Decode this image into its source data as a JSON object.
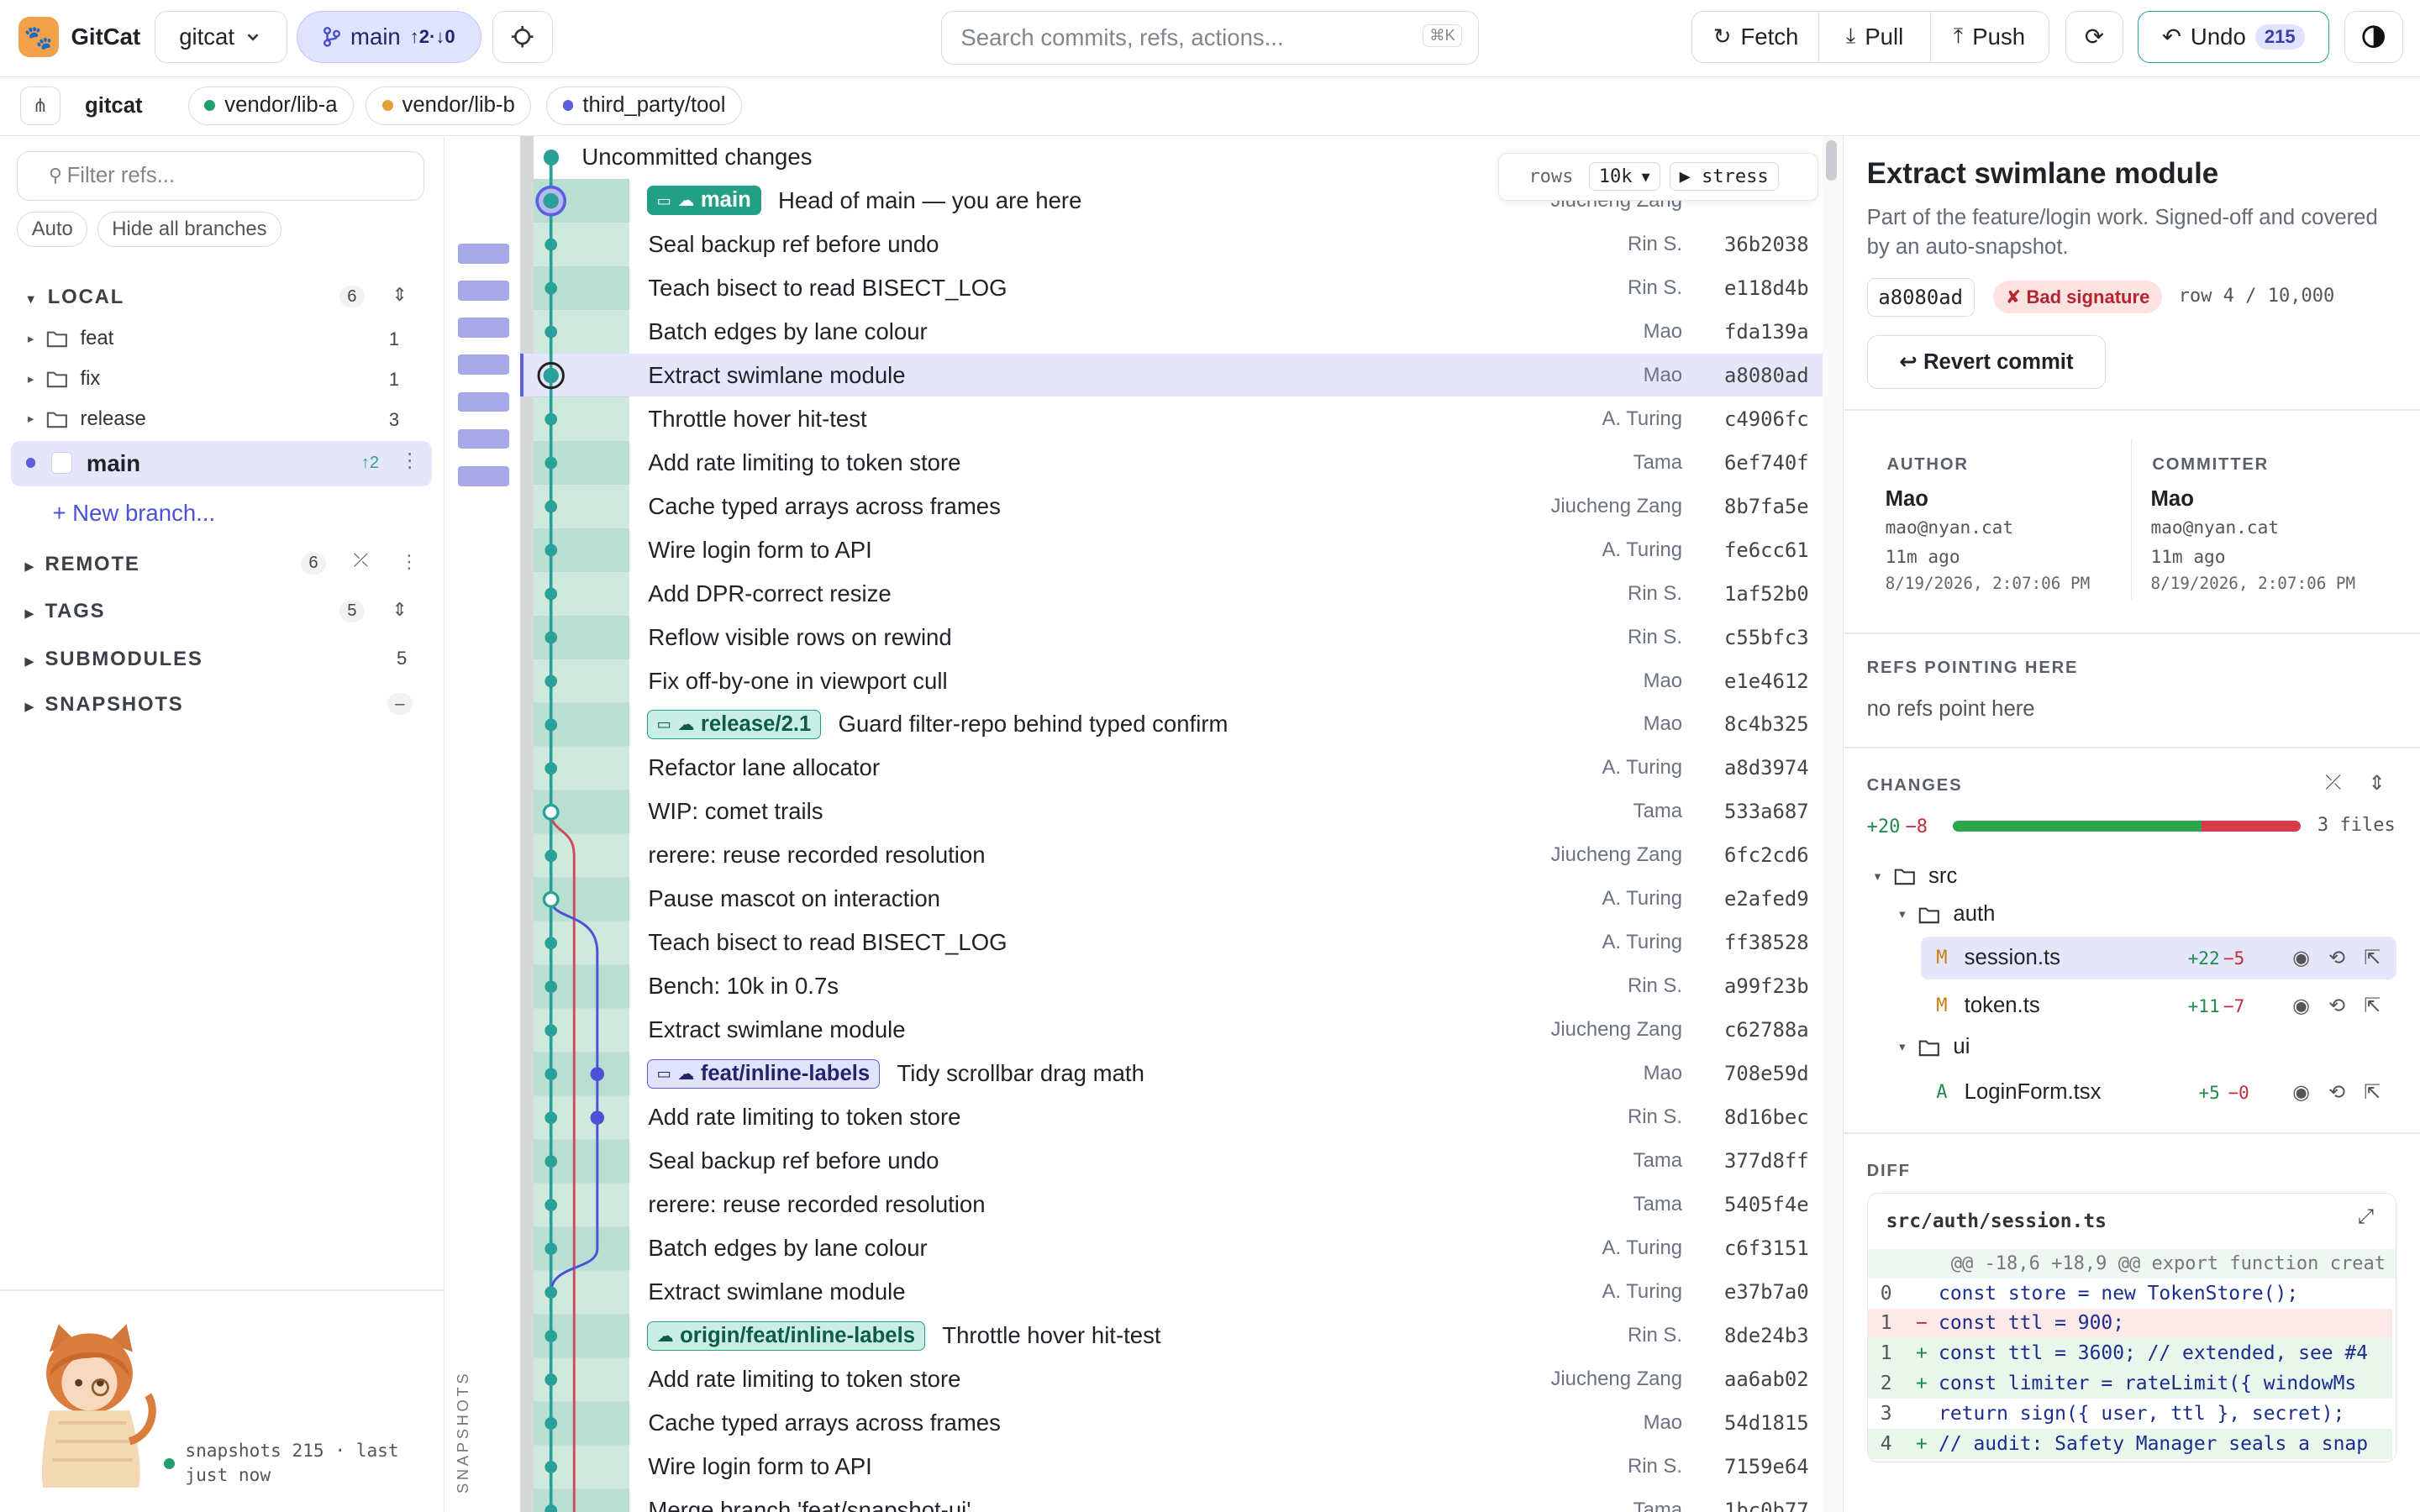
{
  "app": {
    "name": "GitCat",
    "repo": "gitcat",
    "branch": "main",
    "ahead_behind": "↑2·↓0"
  },
  "search": {
    "placeholder": "Search commits, refs, actions...",
    "shortcut": "⌘K"
  },
  "toolbar": {
    "fetch": "Fetch",
    "pull": "Pull",
    "push": "Push",
    "undo": "Undo",
    "undo_count": "215"
  },
  "subbar": {
    "root": "gitcat",
    "submodules": [
      {
        "name": "vendor/lib-a",
        "color": "#22a06b"
      },
      {
        "name": "vendor/lib-b",
        "color": "#e2a13a"
      },
      {
        "name": "third_party/tool",
        "color": "#5b5fe0"
      }
    ]
  },
  "sidebar": {
    "filter_placeholder": "Filter refs...",
    "auto": "Auto",
    "hide_all": "Hide all branches",
    "local": {
      "label": "LOCAL",
      "count": "6",
      "folders": [
        {
          "name": "feat",
          "count": "1"
        },
        {
          "name": "fix",
          "count": "1"
        },
        {
          "name": "release",
          "count": "3"
        }
      ],
      "current": {
        "name": "main",
        "ahead": "↑2"
      },
      "new_branch": "+ New branch..."
    },
    "remote": {
      "label": "REMOTE",
      "count": "6"
    },
    "tags": {
      "label": "TAGS",
      "count": "5"
    },
    "submodules": {
      "label": "SUBMODULES",
      "count": "5"
    },
    "snapshots": {
      "label": "SNAPSHOTS",
      "count": "–"
    },
    "status": "snapshots 215 · last just now",
    "snapshots_vertical": "SNAPSHOTS"
  },
  "graph": {
    "uncommitted": "Uncommitted changes",
    "overlay": {
      "rows_label": "rows",
      "rows_value": "10k",
      "stress": "▶ stress"
    },
    "commits": [
      {
        "msg": "Head of main — you are here",
        "author": "Jiucheng Zang",
        "sha": "",
        "ref": "main",
        "refkind": "main"
      },
      {
        "msg": "Seal backup ref before undo",
        "author": "Rin S.",
        "sha": "36b2038"
      },
      {
        "msg": "Teach bisect to read BISECT_LOG",
        "author": "Rin S.",
        "sha": "e118d4b"
      },
      {
        "msg": "Batch edges by lane colour",
        "author": "Mao",
        "sha": "fda139a"
      },
      {
        "msg": "Extract swimlane module",
        "author": "Mao",
        "sha": "a8080ad"
      },
      {
        "msg": "Throttle hover hit-test",
        "author": "A. Turing",
        "sha": "c4906fc"
      },
      {
        "msg": "Add rate limiting to token store",
        "author": "Tama",
        "sha": "6ef740f"
      },
      {
        "msg": "Cache typed arrays across frames",
        "author": "Jiucheng Zang",
        "sha": "8b7fa5e"
      },
      {
        "msg": "Wire login form to API",
        "author": "A. Turing",
        "sha": "fe6cc61"
      },
      {
        "msg": "Add DPR-correct resize",
        "author": "Rin S.",
        "sha": "1af52b0"
      },
      {
        "msg": "Reflow visible rows on rewind",
        "author": "Rin S.",
        "sha": "c55bfc3"
      },
      {
        "msg": "Fix off-by-one in viewport cull",
        "author": "Mao",
        "sha": "e1e4612"
      },
      {
        "msg": "Guard filter-repo behind typed confirm",
        "author": "Mao",
        "sha": "8c4b325",
        "ref": "release/2.1",
        "refkind": "release"
      },
      {
        "msg": "Refactor lane allocator",
        "author": "A. Turing",
        "sha": "a8d3974"
      },
      {
        "msg": "WIP: comet trails",
        "author": "Tama",
        "sha": "533a687"
      },
      {
        "msg": "rerere: reuse recorded resolution",
        "author": "Jiucheng Zang",
        "sha": "6fc2cd6"
      },
      {
        "msg": "Pause mascot on interaction",
        "author": "A. Turing",
        "sha": "e2afed9"
      },
      {
        "msg": "Teach bisect to read BISECT_LOG",
        "author": "A. Turing",
        "sha": "ff38528"
      },
      {
        "msg": "Bench: 10k in 0.7s",
        "author": "Rin S.",
        "sha": "a99f23b"
      },
      {
        "msg": "Extract swimlane module",
        "author": "Jiucheng Zang",
        "sha": "c62788a"
      },
      {
        "msg": "Tidy scrollbar drag math",
        "author": "Mao",
        "sha": "708e59d",
        "ref": "feat/inline-labels",
        "refkind": "feat"
      },
      {
        "msg": "Add rate limiting to token store",
        "author": "Rin S.",
        "sha": "8d16bec"
      },
      {
        "msg": "Seal backup ref before undo",
        "author": "Tama",
        "sha": "377d8ff"
      },
      {
        "msg": "rerere: reuse recorded resolution",
        "author": "Tama",
        "sha": "5405f4e"
      },
      {
        "msg": "Batch edges by lane colour",
        "author": "A. Turing",
        "sha": "c6f3151"
      },
      {
        "msg": "Extract swimlane module",
        "author": "A. Turing",
        "sha": "e37b7a0"
      },
      {
        "msg": "Throttle hover hit-test",
        "author": "Rin S.",
        "sha": "8de24b3",
        "ref": "origin/feat/inline-labels",
        "refkind": "origin"
      },
      {
        "msg": "Add rate limiting to token store",
        "author": "Jiucheng Zang",
        "sha": "aa6ab02"
      },
      {
        "msg": "Cache typed arrays across frames",
        "author": "Mao",
        "sha": "54d1815"
      },
      {
        "msg": "Wire login form to API",
        "author": "Rin S.",
        "sha": "7159e64"
      },
      {
        "msg": "Merge branch 'feat/snapshot-ui'",
        "author": "Tama",
        "sha": "1bc0b77"
      }
    ]
  },
  "detail": {
    "title": "Extract swimlane module",
    "description": "Part of the feature/login work. Signed-off and covered by an auto-snapshot.",
    "sha": "a8080ad",
    "signature": "✘ Bad signature",
    "row": "row 4 / 10,000",
    "revert": "↩ Revert commit",
    "author": {
      "label": "AUTHOR",
      "name": "Mao",
      "email": "mao@nyan.cat",
      "ago": "11m ago",
      "date": "8/19/2026, 2:07:06 PM"
    },
    "committer": {
      "label": "COMMITTER",
      "name": "Mao",
      "email": "mao@nyan.cat",
      "ago": "11m ago",
      "date": "8/19/2026, 2:07:06 PM"
    },
    "refs": {
      "label": "REFS POINTING HERE",
      "empty": "no refs point here"
    },
    "changes": {
      "label": "CHANGES",
      "added": "+20",
      "removed": "−8",
      "added_value": 20,
      "removed_value": 8,
      "files": "3 files",
      "tree": {
        "src": "src",
        "auth": "auth",
        "ui": "ui"
      },
      "list": [
        {
          "status": "M",
          "name": "session.ts",
          "add": "+22",
          "del": "−5"
        },
        {
          "status": "M",
          "name": "token.ts",
          "add": "+11",
          "del": "−7"
        },
        {
          "status": "A",
          "name": "LoginForm.tsx",
          "add": "+5",
          "del": "−0"
        }
      ]
    },
    "diff": {
      "label": "DIFF",
      "file": "src/auth/session.ts",
      "hunk": "@@ -18,6 +18,9 @@ export function creat",
      "lines": [
        {
          "n": "0",
          "sign": "",
          "kind": "ctx",
          "code": "const store = new TokenStore();"
        },
        {
          "n": "1",
          "sign": "−",
          "kind": "del",
          "code": "const ttl = 900;"
        },
        {
          "n": "1",
          "sign": "+",
          "kind": "add",
          "code": "const ttl = 3600; // extended, see #4"
        },
        {
          "n": "2",
          "sign": "+",
          "kind": "add",
          "code": "const limiter = rateLimit({ windowMs"
        },
        {
          "n": "3",
          "sign": "",
          "kind": "ctx",
          "code": "return sign({ user, ttl }, secret);"
        },
        {
          "n": "4",
          "sign": "+",
          "kind": "add",
          "code": "// audit: Safety Manager seals a snap"
        }
      ]
    }
  },
  "colors": {
    "accent": "#5b5fe0",
    "main_lane": "#2aa198",
    "purple_lane": "#4b52d8",
    "red_lane": "#d14a5a",
    "selected_row": "#e6e6fb"
  }
}
